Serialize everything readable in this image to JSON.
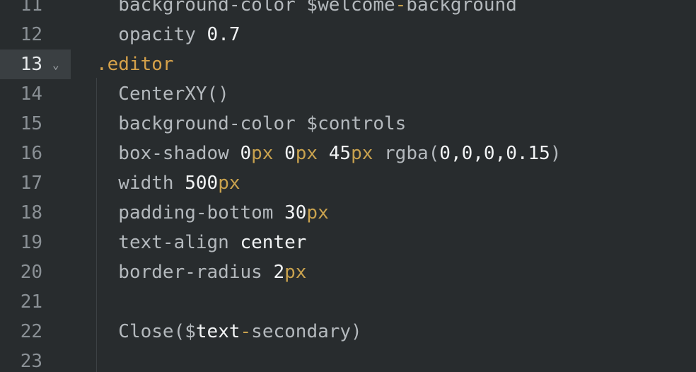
{
  "editor": {
    "lines": [
      {
        "number": "11",
        "segments": [
          {
            "text": "  background-color $welcome",
            "cls": "t-plain"
          },
          {
            "text": "-",
            "cls": "t-op"
          },
          {
            "text": "background",
            "cls": "t-plain"
          }
        ]
      },
      {
        "number": "12",
        "segments": [
          {
            "text": "  opacity ",
            "cls": "t-plain"
          },
          {
            "text": "0.7",
            "cls": "t-num"
          }
        ]
      },
      {
        "number": "13",
        "active": true,
        "foldable": true,
        "segments": [
          {
            "text": ".editor",
            "cls": "t-sel"
          }
        ]
      },
      {
        "number": "14",
        "segments": [
          {
            "text": "  CenterXY()",
            "cls": "t-plain"
          }
        ]
      },
      {
        "number": "15",
        "segments": [
          {
            "text": "  background-color $controls",
            "cls": "t-plain"
          }
        ]
      },
      {
        "number": "16",
        "segments": [
          {
            "text": "  box-shadow ",
            "cls": "t-plain"
          },
          {
            "text": "0",
            "cls": "t-num"
          },
          {
            "text": "px",
            "cls": "t-unit"
          },
          {
            "text": " ",
            "cls": "t-plain"
          },
          {
            "text": "0",
            "cls": "t-num"
          },
          {
            "text": "px",
            "cls": "t-unit"
          },
          {
            "text": " ",
            "cls": "t-plain"
          },
          {
            "text": "45",
            "cls": "t-num"
          },
          {
            "text": "px",
            "cls": "t-unit"
          },
          {
            "text": " rgba(",
            "cls": "t-plain"
          },
          {
            "text": "0,0,0,0.15",
            "cls": "t-num"
          },
          {
            "text": ")",
            "cls": "t-plain"
          }
        ]
      },
      {
        "number": "17",
        "segments": [
          {
            "text": "  width ",
            "cls": "t-plain"
          },
          {
            "text": "500",
            "cls": "t-num"
          },
          {
            "text": "px",
            "cls": "t-unit"
          }
        ]
      },
      {
        "number": "18",
        "segments": [
          {
            "text": "  padding-bottom ",
            "cls": "t-plain"
          },
          {
            "text": "30",
            "cls": "t-num"
          },
          {
            "text": "px",
            "cls": "t-unit"
          }
        ]
      },
      {
        "number": "19",
        "segments": [
          {
            "text": "  text-align ",
            "cls": "t-plain"
          },
          {
            "text": "center",
            "cls": "t-bright"
          }
        ]
      },
      {
        "number": "20",
        "segments": [
          {
            "text": "  border-radius ",
            "cls": "t-plain"
          },
          {
            "text": "2",
            "cls": "t-num"
          },
          {
            "text": "px",
            "cls": "t-unit"
          }
        ]
      },
      {
        "number": "21",
        "segments": []
      },
      {
        "number": "22",
        "segments": [
          {
            "text": "  Close($",
            "cls": "t-plain"
          },
          {
            "text": "text",
            "cls": "t-bright"
          },
          {
            "text": "-",
            "cls": "t-op"
          },
          {
            "text": "secondary)",
            "cls": "t-plain"
          }
        ]
      },
      {
        "number": "23",
        "segments": []
      }
    ],
    "fold_icon": "chevron-down-icon",
    "colors": {
      "background": "#282c2e",
      "active_gutter": "#3a3f42",
      "selector": "#d6a24a",
      "unit": "#c9a24e",
      "number": "#f2f4f5",
      "plain": "#b4b9bd"
    }
  }
}
